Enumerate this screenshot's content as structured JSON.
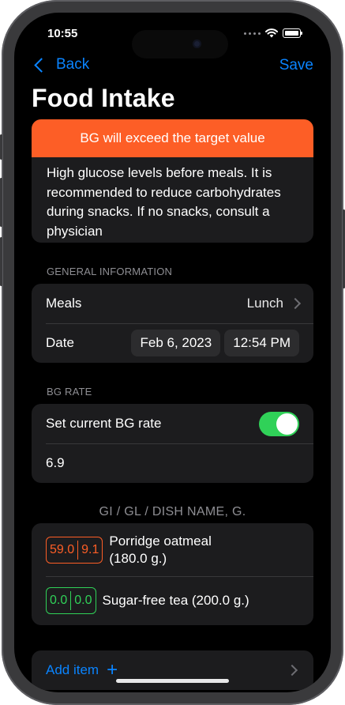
{
  "status": {
    "time": "10:55"
  },
  "nav": {
    "back_label": "Back",
    "save_label": "Save"
  },
  "page": {
    "title": "Food Intake"
  },
  "warning": {
    "banner": "BG will exceed the target value",
    "message": "High glucose levels before meals. It is recommended to reduce carbohydrates during snacks. If no snacks, consult a physician"
  },
  "general": {
    "section_label": "GENERAL INFORMATION",
    "meals_label": "Meals",
    "meals_value": "Lunch",
    "date_label": "Date",
    "date_value": "Feb 6, 2023",
    "time_value": "12:54 PM"
  },
  "bg": {
    "section_label": "BG RATE",
    "toggle_label": "Set current BG rate",
    "toggle_on": true,
    "rate_value": "6.9"
  },
  "dishes": {
    "header": "GI / GL / DISH NAME, G.",
    "items": [
      {
        "gi": "59.0",
        "gl": "9.1",
        "name": "Porridge oatmeal",
        "weight": "(180.0 g.)",
        "color": "#fd5e26"
      },
      {
        "gi": "0.0",
        "gl": "0.0",
        "name": "Sugar-free tea (200.0 g.)",
        "color": "#30d158"
      }
    ]
  },
  "add_item": {
    "label": "Add item"
  },
  "colors": {
    "accent": "#0a84ff",
    "warning": "#fd5e26",
    "success": "#30d158",
    "background": "#000000",
    "card": "#1c1c1e"
  }
}
